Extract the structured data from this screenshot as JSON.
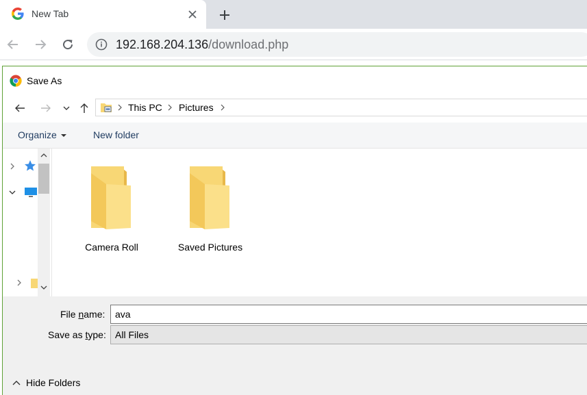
{
  "browser": {
    "tab": {
      "title": "New Tab"
    },
    "address": {
      "host": "192.168.204.136",
      "path": "/download.php"
    }
  },
  "dialog": {
    "title": "Save As",
    "breadcrumb": [
      "This PC",
      "Pictures"
    ],
    "commands": {
      "organize": "Organize",
      "new_folder": "New folder"
    },
    "folders": [
      {
        "name": "Camera Roll"
      },
      {
        "name": "Saved Pictures"
      }
    ],
    "file_name": {
      "label_pre": "File ",
      "label_key": "n",
      "label_post": "ame:",
      "value": "ava"
    },
    "save_as_type": {
      "label_pre": "Save as ",
      "label_key": "t",
      "label_post": "ype:",
      "value": "All Files"
    },
    "hide_folders": "Hide Folders"
  },
  "colors": {
    "tabstrip": "#dee1e6",
    "omnibox": "#f1f3f4",
    "dialog_border": "#5ea135",
    "folder_yellow": "#f8d775",
    "folder_dark": "#e8b84a"
  },
  "icons": [
    "google-g-icon",
    "close-icon",
    "plus-icon",
    "back-icon",
    "forward-icon",
    "reload-icon",
    "info-icon",
    "chrome-icon",
    "up-icon",
    "chevron-down-icon",
    "folder-icon",
    "star-icon",
    "monitor-icon",
    "chevron-up-icon"
  ]
}
